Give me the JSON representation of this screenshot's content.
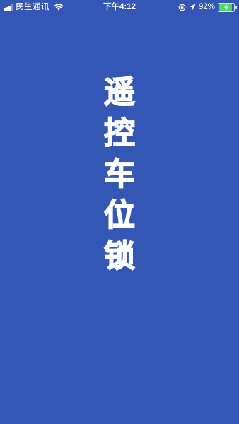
{
  "status_bar": {
    "carrier": "民生通讯",
    "time": "下午4:12",
    "battery_percent": "92%",
    "signal_bars_active": 3,
    "signal_bars_total": 4,
    "battery_level": 0.92,
    "icons": {
      "signal": "cellular-signal-icon",
      "wifi": "wifi-icon",
      "orientation_lock": "orientation-lock-icon",
      "location": "location-arrow-icon",
      "battery": "battery-charging-icon"
    }
  },
  "splash": {
    "title_chars": [
      "遥",
      "控",
      "车",
      "位",
      "锁"
    ]
  },
  "colors": {
    "background": "#3456b5",
    "text": "#ffffff",
    "battery_fill": "#4cd964"
  }
}
